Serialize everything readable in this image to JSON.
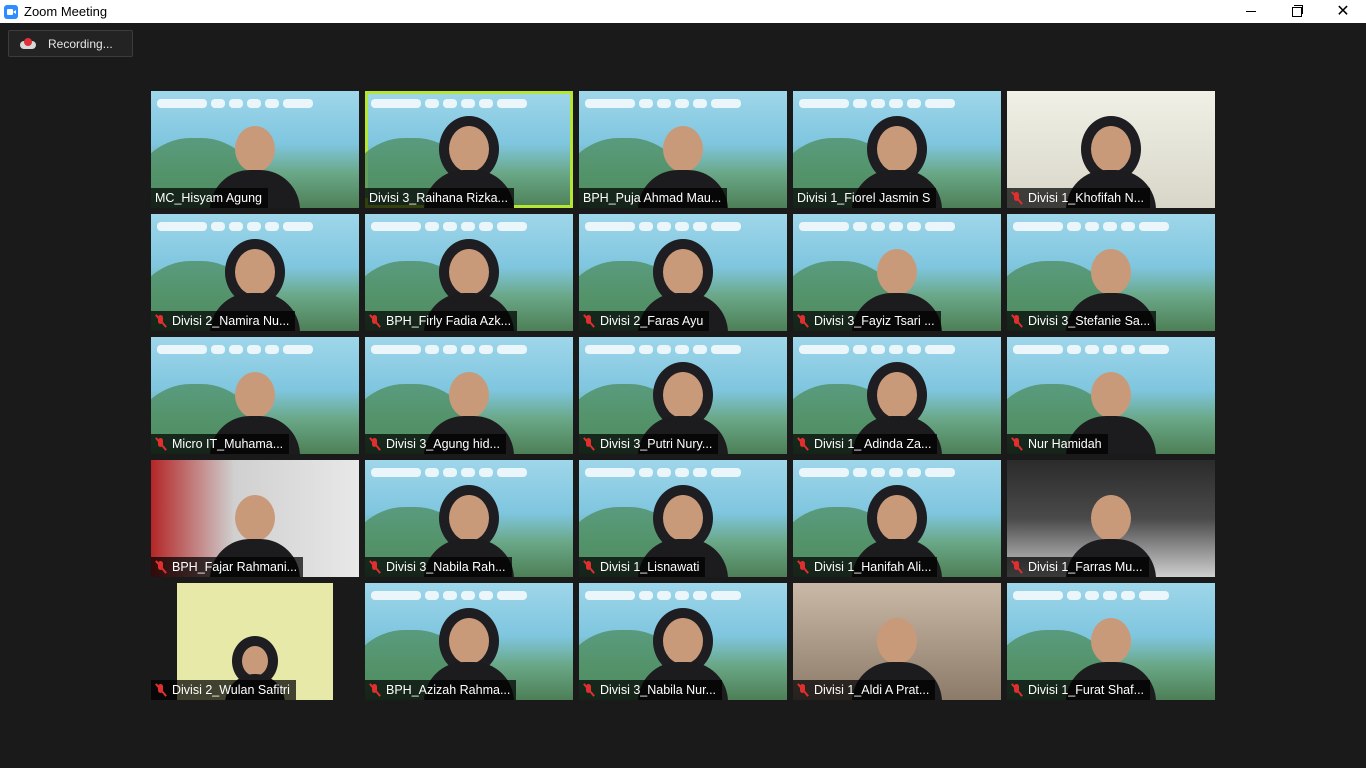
{
  "window": {
    "title": "Zoom Meeting",
    "controls": {
      "minimize": "minimize",
      "maximize": "maximize",
      "close": "close"
    }
  },
  "recording": {
    "label": "Recording..."
  },
  "participants": [
    {
      "name": "MC_Hisyam Agung",
      "muted": false,
      "style": "banner"
    },
    {
      "name": "Divisi 3_Raihana Rizka...",
      "muted": false,
      "style": "banner-hijab",
      "active_speaker": true
    },
    {
      "name": "BPH_Puja Ahmad Mau...",
      "muted": false,
      "style": "banner"
    },
    {
      "name": "Divisi 1_Fiorel Jasmin S",
      "muted": false,
      "style": "banner-hijab"
    },
    {
      "name": "Divisi 1_Khofifah N...",
      "muted": true,
      "style": "plain-hijab"
    },
    {
      "name": "Divisi 2_Namira Nu...",
      "muted": true,
      "style": "banner-hijab"
    },
    {
      "name": "BPH_Firly Fadia Azk...",
      "muted": true,
      "style": "banner-hijab"
    },
    {
      "name": "Divisi 2_Faras Ayu",
      "muted": true,
      "style": "banner-hijab"
    },
    {
      "name": "Divisi 3_Fayiz Tsari ...",
      "muted": true,
      "style": "banner"
    },
    {
      "name": "Divisi 3_Stefanie Sa...",
      "muted": true,
      "style": "banner"
    },
    {
      "name": "Micro IT_Muhama...",
      "muted": true,
      "style": "banner"
    },
    {
      "name": "Divisi 3_Agung hid...",
      "muted": true,
      "style": "banner"
    },
    {
      "name": "Divisi 3_Putri Nury...",
      "muted": true,
      "style": "banner-hijab"
    },
    {
      "name": "Divisi 1_ Adinda Za...",
      "muted": true,
      "style": "banner-hijab"
    },
    {
      "name": "Nur Hamidah",
      "muted": true,
      "style": "banner"
    },
    {
      "name": "BPH_Fajar Rahmani...",
      "muted": true,
      "style": "red"
    },
    {
      "name": "Divisi 3_Nabila Rah...",
      "muted": true,
      "style": "banner-hijab"
    },
    {
      "name": "Divisi 1_Lisnawati",
      "muted": true,
      "style": "banner-hijab"
    },
    {
      "name": "Divisi 1_Hanifah Ali...",
      "muted": true,
      "style": "banner-hijab"
    },
    {
      "name": "Divisi 1_Farras Mu...",
      "muted": true,
      "style": "dark"
    },
    {
      "name": "Divisi 2_Wulan Safitri",
      "muted": true,
      "style": "wulan"
    },
    {
      "name": "BPH_Azizah Rahma...",
      "muted": true,
      "style": "banner-hijab"
    },
    {
      "name": "Divisi 3_Nabila Nur...",
      "muted": true,
      "style": "banner-hijab"
    },
    {
      "name": "Divisi 1_Aldi A Prat...",
      "muted": true,
      "style": "room"
    },
    {
      "name": "Divisi 1_Furat Shaf...",
      "muted": true,
      "style": "banner"
    }
  ],
  "colors": {
    "active_speaker": "#b6e634",
    "muted_mic": "#e02f2f",
    "background": "#1a1a1a"
  }
}
